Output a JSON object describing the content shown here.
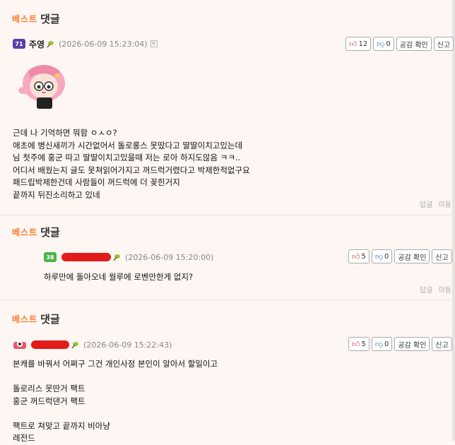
{
  "comments": [
    {
      "best_label": "베스트",
      "best_suffix": "댓글",
      "level": "71",
      "author": "주영",
      "date": "(2026-06-09 15:23:04)",
      "likes": "12",
      "dislikes": "0",
      "empathy": "공감 확인",
      "report": "신고",
      "text": "근데 나 기억하면 뭐함 ㅇㅅㅇ?\n애초에 병신새끼가 시간없어서 돌로롱스 못땄다고 딸딸이치고있는데\n님 첫주에 홍군 따고 딸딸이치고있을때 저는 로아 하지도않음 ㅋㅋ..\n어디서 배웠는지 글도 못쳐읽어가지고 꺼드럭거렸다고 박제한적없구요\n패드립박제한건데 사람들이 꺼드럭에 더 꽂힌거지\n끝까지 뒤진소리하고 있네",
      "reply": "답글",
      "move": "이동"
    },
    {
      "best_label": "베스트",
      "best_suffix": "댓글",
      "level": "38",
      "date": "(2026-06-09 15:20:00)",
      "likes": "5",
      "dislikes": "0",
      "empathy": "공감 확인",
      "report": "신고",
      "text": "하루만에 돌아오네 월루에 로벤만한게 없지?",
      "reply": "답글",
      "move": "이동"
    },
    {
      "best_label": "베스트",
      "best_suffix": "댓글",
      "date": "(2026-06-09 15:22:43)",
      "likes": "5",
      "dislikes": "0",
      "empathy": "공감 확인",
      "report": "신고",
      "text": "본캐를 바꿔서 어쩌구 그건 개인사정 본인이 알아서 할일이고\n\n돌로리스 못딴거 팩트\n홍군 꺼드럭댄거 팩트\n\n팩트로 쳐맞고 끝까지 비아냥\n레전드"
    }
  ],
  "colors": {
    "best_orange": "#ff7a2a",
    "thumb_up": "#d2343b",
    "thumb_down": "#2b6cc9",
    "redaction": "#e21b1b"
  }
}
